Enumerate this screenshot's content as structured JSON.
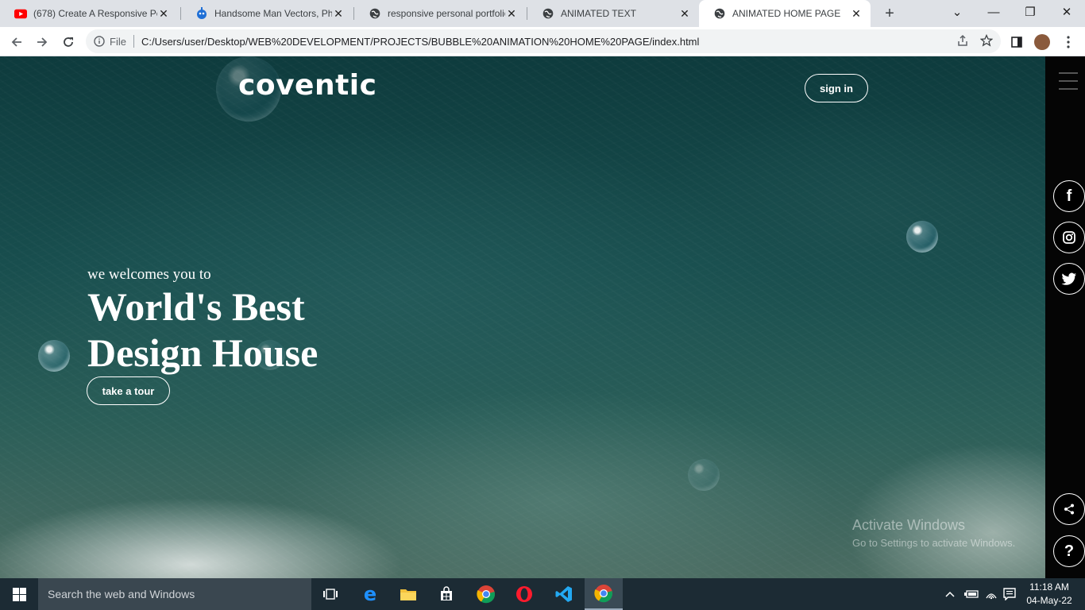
{
  "browser": {
    "tabs": [
      {
        "title": "(678) Create A Responsive Pe",
        "favicon": "youtube-icon",
        "active": false
      },
      {
        "title": "Handsome Man Vectors, Pho",
        "favicon": "freepik-icon",
        "active": false
      },
      {
        "title": "responsive personal portfolio",
        "favicon": "globe-icon",
        "active": false
      },
      {
        "title": "ANIMATED TEXT",
        "favicon": "globe-icon",
        "active": false
      },
      {
        "title": "ANIMATED HOME PAGE",
        "favicon": "globe-icon",
        "active": true
      }
    ],
    "new_tab": "+",
    "file_label": "File",
    "url": "C:/Users/user/Desktop/WEB%20DEVELOPMENT/PROJECTS/BUBBLE%20ANIMATION%20HOME%20PAGE/index.html"
  },
  "page": {
    "logo": "coventic",
    "sign_in": "sign in",
    "welcome": "we welcomes you to",
    "headline_line1": "World's Best",
    "headline_line2": "Design House",
    "tour_button": "take a tour",
    "activate_title": "Activate Windows",
    "activate_sub": "Go to Settings to activate Windows."
  },
  "sidebar": {
    "social": [
      {
        "name": "facebook-icon",
        "glyph": "f"
      },
      {
        "name": "instagram-icon",
        "glyph": ""
      },
      {
        "name": "twitter-icon",
        "glyph": ""
      }
    ],
    "share_icon": "share-icon",
    "help": "?"
  },
  "taskbar": {
    "search_placeholder": "Search the web and Windows",
    "time": "11:18 AM",
    "date": "04-May-22"
  },
  "colors": {
    "ocean_dark": "#0e3b3d",
    "ocean_mid": "#2b5e58",
    "sidebar": "#050505",
    "taskbar": "#1c2b34"
  }
}
